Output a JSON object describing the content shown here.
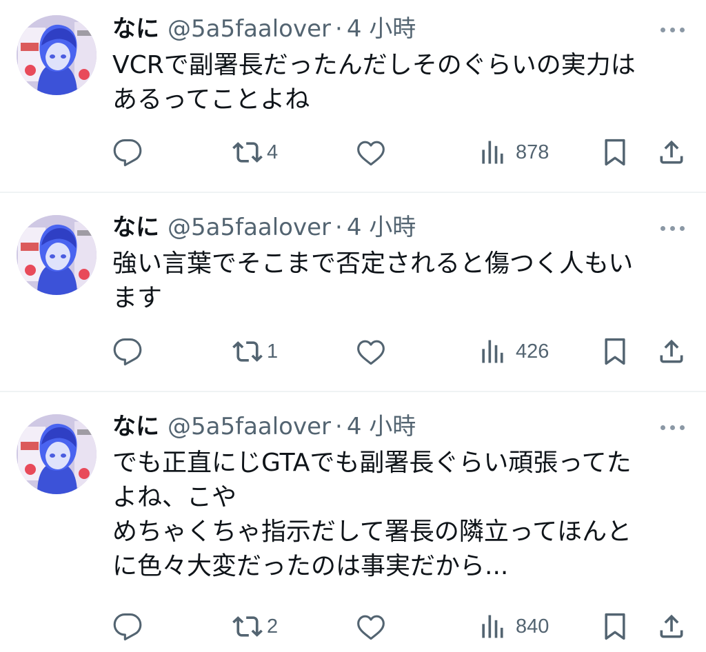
{
  "colors": {
    "text_primary": "#0f1419",
    "text_secondary": "#536471",
    "divider": "#eff3f4"
  },
  "tweets": [
    {
      "author": {
        "name": "なに",
        "handle": "@5a5faalover",
        "separator": "·",
        "time": "4 小時"
      },
      "text_lines": [
        "VCRで副署長だったんだしそのぐらいの実力は",
        "あるってことよね"
      ],
      "stats": {
        "replies": "",
        "retweets": "4",
        "likes": "",
        "views": "878"
      },
      "icons": [
        "reply-icon",
        "retweet-icon",
        "like-icon",
        "views-icon",
        "bookmark-icon",
        "share-icon",
        "more-icon"
      ]
    },
    {
      "author": {
        "name": "なに",
        "handle": "@5a5faalover",
        "separator": "·",
        "time": "4 小時"
      },
      "text_lines": [
        "強い言葉でそこまで否定されると傷つく人もい",
        "ます"
      ],
      "stats": {
        "replies": "",
        "retweets": "1",
        "likes": "",
        "views": "426"
      },
      "icons": [
        "reply-icon",
        "retweet-icon",
        "like-icon",
        "views-icon",
        "bookmark-icon",
        "share-icon",
        "more-icon"
      ]
    },
    {
      "author": {
        "name": "なに",
        "handle": "@5a5faalover",
        "separator": "·",
        "time": "4 小時"
      },
      "text_lines": [
        "でも正直にじGTAでも副署長ぐらい頑張ってた",
        "よね、こや",
        "めちゃくちゃ指示だして署長の隣立ってほんと",
        "に色々大変だったのは事実だから..."
      ],
      "stats": {
        "replies": "",
        "retweets": "2",
        "likes": "",
        "views": "840"
      },
      "icons": [
        "reply-icon",
        "retweet-icon",
        "like-icon",
        "views-icon",
        "bookmark-icon",
        "share-icon",
        "more-icon"
      ]
    }
  ]
}
